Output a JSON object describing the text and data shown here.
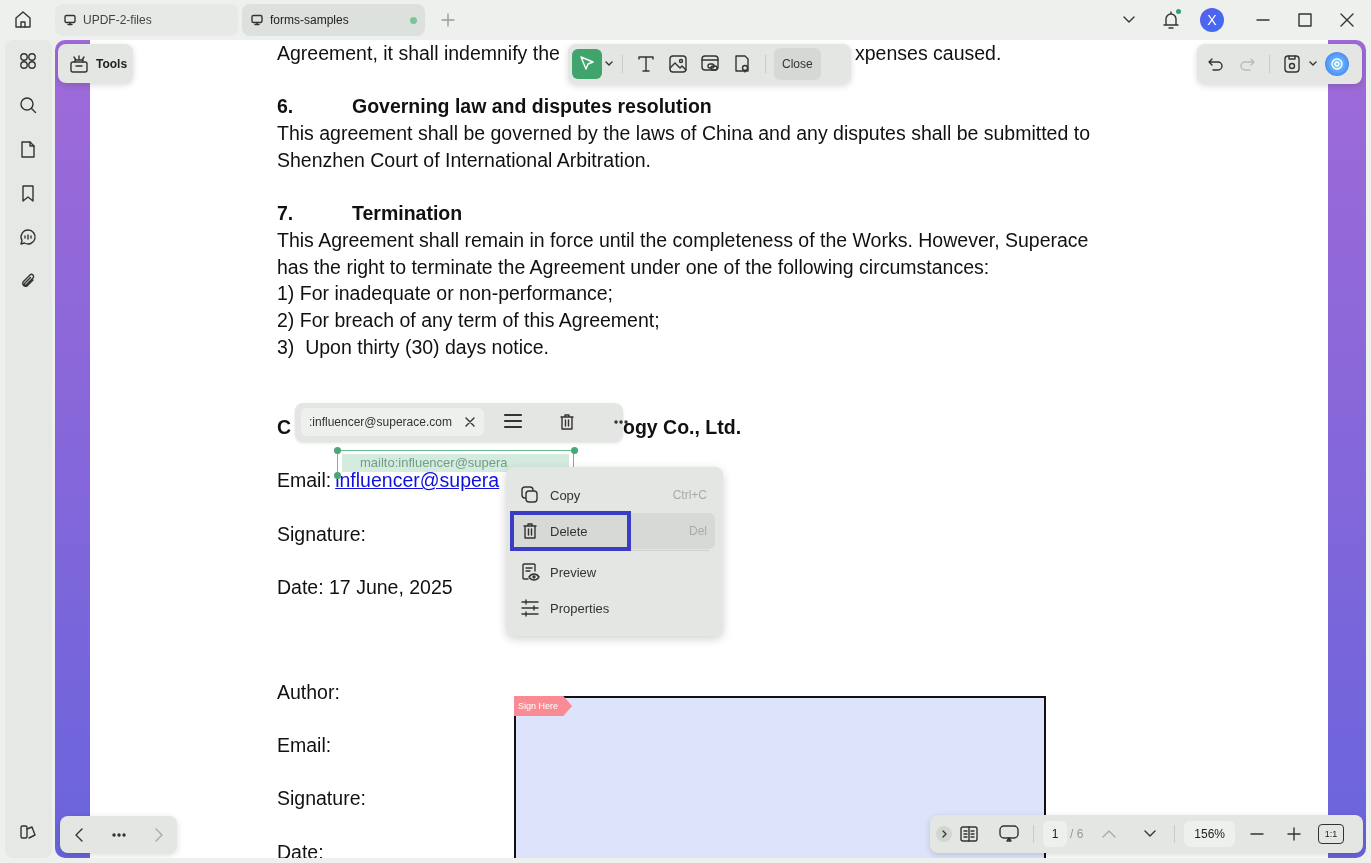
{
  "tabs": [
    {
      "label": "UPDF-2-files",
      "selected": false,
      "unsaved": false
    },
    {
      "label": "forms-samples",
      "selected": true,
      "unsaved": true
    }
  ],
  "notifications": {
    "unread": true
  },
  "account": {
    "initial": "X"
  },
  "tools_button": {
    "label": "Tools"
  },
  "annotation_toolbar": {
    "tools": [
      {
        "kind": "select",
        "selected": true
      },
      {
        "kind": "text",
        "selected": false
      },
      {
        "kind": "image",
        "selected": false
      },
      {
        "kind": "link",
        "selected": false
      },
      {
        "kind": "location",
        "selected": false
      }
    ],
    "close_label": "Close"
  },
  "history": {
    "undo_enabled": true,
    "redo_enabled": false
  },
  "document": {
    "intro_line": {
      "before": "Agreement, it shall indemnify the",
      "after": "xpenses caused."
    },
    "clauses": [
      {
        "number": "6.",
        "title": "Governing law and disputes resolution",
        "lines": [
          "This agreement shall be governed by the laws of China and any disputes shall be submitted to",
          "Shenzhen Court of International Arbitration."
        ]
      },
      {
        "number": "7.",
        "title": "Termination",
        "lines": [
          "This Agreement shall remain in force until the completeness of the Works. However, Superace",
          "has the right to terminate the Agreement under one of the following circumstances:"
        ],
        "items": [
          "1) For inadequate or non-performance;",
          "2) For breach of any term of this Agreement;",
          "3)  Upon thirty (30) days notice."
        ]
      }
    ],
    "parties": [
      {
        "company": {
          "start": "C",
          "end": "ogy Co., Ltd."
        },
        "fields": [
          {
            "label": "Email:",
            "link": "influencer@supera"
          },
          {
            "label": "Signature:"
          },
          {
            "label": "Date: 17 June, 2025"
          }
        ]
      },
      {
        "fields": [
          {
            "label": "Author:"
          },
          {
            "label": "Email:"
          },
          {
            "label": "Signature:"
          },
          {
            "label": "Date:"
          }
        ]
      }
    ]
  },
  "link_popup": {
    "url": ":influencer@superace.com"
  },
  "link_selection": {
    "text": "mailto:influencer@supera"
  },
  "context_menu": {
    "items": [
      {
        "label": "Copy",
        "shortcut": "Ctrl+C",
        "selected": false
      },
      {
        "label": "Delete",
        "shortcut": "Del",
        "selected": true
      },
      {
        "label": "Preview",
        "selected": false
      },
      {
        "label": "Properties",
        "selected": false
      }
    ]
  },
  "sign_field": {
    "tag": "Sign Here"
  },
  "page_nav": {
    "current": "1",
    "total": "/ 6",
    "zoom": "156%",
    "zoom_reset": "1:1"
  }
}
